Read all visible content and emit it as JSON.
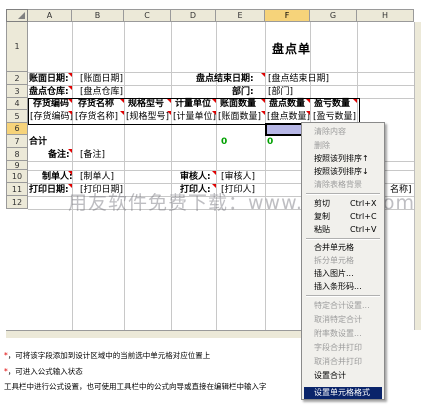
{
  "columns": [
    "A",
    "B",
    "C",
    "D",
    "E",
    "F",
    "G",
    "H"
  ],
  "rows": [
    "1",
    "2",
    "3",
    "4",
    "5",
    "6",
    "7",
    "8",
    "9",
    "10",
    "11",
    "12"
  ],
  "title": "盘点单",
  "labels": {
    "date": "账面日期:",
    "date_val": "[账面日期]",
    "end_date": "盘点结束日期:",
    "end_date_val": "[盘点结束日期]",
    "wh": "盘点仓库:",
    "wh_val": "[盘点仓库]",
    "dept": "部门:",
    "dept_val": "[部门]",
    "total": "合计",
    "remark": "备注:",
    "remark_val": "[备注]",
    "maker": "制单人:",
    "maker_val": "[制单人]",
    "auditor": "审核人:",
    "auditor_val": "[审核人]",
    "print_date": "打印日期:",
    "print_date_val": "[打印日期]",
    "printer": "打印人:",
    "printer_val": "[打印人]",
    "name_tail": "名称]"
  },
  "table": {
    "headers": [
      "存货编码",
      "存货名称",
      "规格型号",
      "计量单位",
      "账面数量",
      "盘点数量",
      "盈亏数量"
    ],
    "fields": [
      "[存货编码]",
      "[存货名称]",
      "[规格型号]",
      "[计量单位]",
      "[账面数量]",
      "[盘点数量]",
      "[盈亏数量]"
    ],
    "zeros": [
      "0",
      "0"
    ]
  },
  "watermark": "用友软件免费下载：www.yyrjzz.com",
  "notes": [
    "，可将该字段添加到设计区域中的当前选中单元格对应位置上",
    "，可进入公式输入状态",
    "工具栏中进行公式设置，也可使用工具栏中的公式向导或直接在编辑栏中输入字"
  ],
  "note_star": "*",
  "menu": {
    "items": [
      {
        "label": "清除内容",
        "enabled": false
      },
      {
        "label": "删除",
        "enabled": false
      },
      {
        "label": "按照该列排序↑",
        "enabled": true
      },
      {
        "label": "按照该列排序↓",
        "enabled": true
      },
      {
        "label": "清除表格背景",
        "enabled": false
      },
      {
        "label": "剪切",
        "accel": "Ctrl+X",
        "enabled": true
      },
      {
        "label": "复制",
        "accel": "Ctrl+C",
        "enabled": true
      },
      {
        "label": "粘贴",
        "accel": "Ctrl+V",
        "enabled": true
      },
      {
        "label": "合并单元格",
        "enabled": true
      },
      {
        "label": "拆分单元格",
        "enabled": false
      },
      {
        "label": "插入图片...",
        "enabled": true
      },
      {
        "label": "插入条形码...",
        "enabled": true
      },
      {
        "label": "特定合计设置...",
        "enabled": false
      },
      {
        "label": "取消特定合计",
        "enabled": false
      },
      {
        "label": "附率数设置...",
        "enabled": false
      },
      {
        "label": "字段合并打印",
        "enabled": false
      },
      {
        "label": "取消合并打印",
        "enabled": false
      },
      {
        "label": "设置合计",
        "enabled": true
      },
      {
        "label": "设置单元格格式",
        "enabled": true,
        "highlighted": true
      }
    ]
  },
  "colors": {
    "accent": "#0a246a",
    "selection": "#b7b7e6",
    "marker": "#e00000",
    "zero": "#00a000"
  }
}
